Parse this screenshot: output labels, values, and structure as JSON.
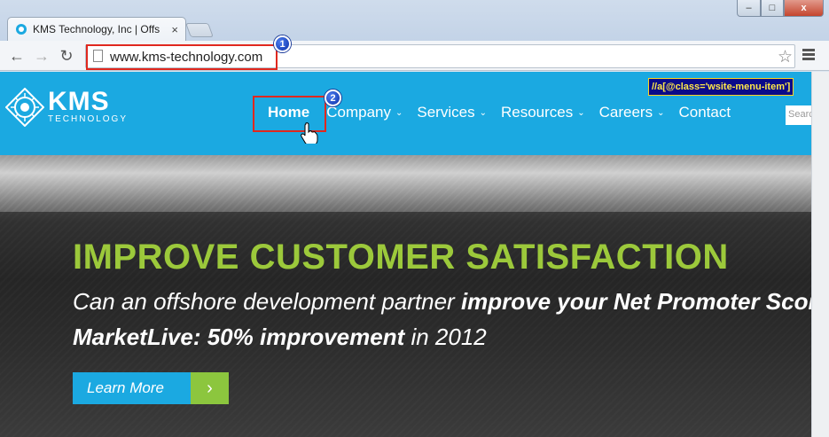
{
  "browser": {
    "tab_title": "KMS Technology, Inc | Offs",
    "tab_close": "×",
    "url": "www.kms-technology.com",
    "win_min": "–",
    "win_max": "□",
    "win_close": "x",
    "back": "←",
    "forward": "→",
    "reload": "↻",
    "star": "☆"
  },
  "annotations": {
    "badge_1": "1",
    "badge_2": "2",
    "xpath_tooltip": "//a[@class='wsite-menu-item']"
  },
  "site": {
    "logo_text": "KMS",
    "logo_subtext": "TECHNOLOGY",
    "nav": {
      "home": "Home",
      "company": "Company",
      "services": "Services",
      "resources": "Resources",
      "careers": "Careers",
      "contact": "Contact",
      "chevron": "⌄"
    },
    "search_placeholder": "Search"
  },
  "hero": {
    "headline": "IMPROVE CUSTOMER SATISFACTION",
    "line1_regular": "Can an offshore development partner ",
    "line1_bold": "improve your Net Promoter Score?",
    "line2_bold": "MarketLive:  50% improvement ",
    "line2_regular": " in 2012",
    "cta_label": "Learn More",
    "cta_arrow": "›"
  },
  "colors": {
    "brand_blue": "#1ba9e1",
    "brand_green": "#9cc93b",
    "highlight_red": "#e0281e"
  }
}
